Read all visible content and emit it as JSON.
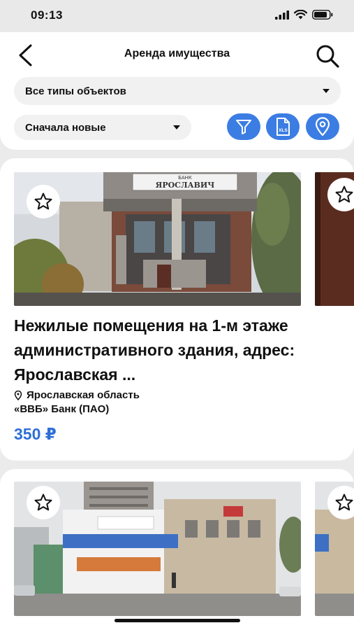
{
  "status_bar": {
    "time": "09:13"
  },
  "header": {
    "title": "Аренда имущества"
  },
  "filters": {
    "type_select": "Все типы объектов",
    "sort_select": "Сначала новые",
    "xls_label": "XLS"
  },
  "listings": [
    {
      "photo_sign": "БАНК",
      "photo_sign_main": "ЯРОСЛАВИЧ",
      "title": "Нежилые помещения на 1-м этаже административного здания, адрес: Ярославская ...",
      "region": "Ярославская область",
      "org": "«ВВБ» Банк (ПАО)",
      "price": "350 ₽"
    }
  ],
  "colors": {
    "accent": "#3b7de3",
    "price": "#2f6fd6",
    "background": "#ebebeb"
  }
}
